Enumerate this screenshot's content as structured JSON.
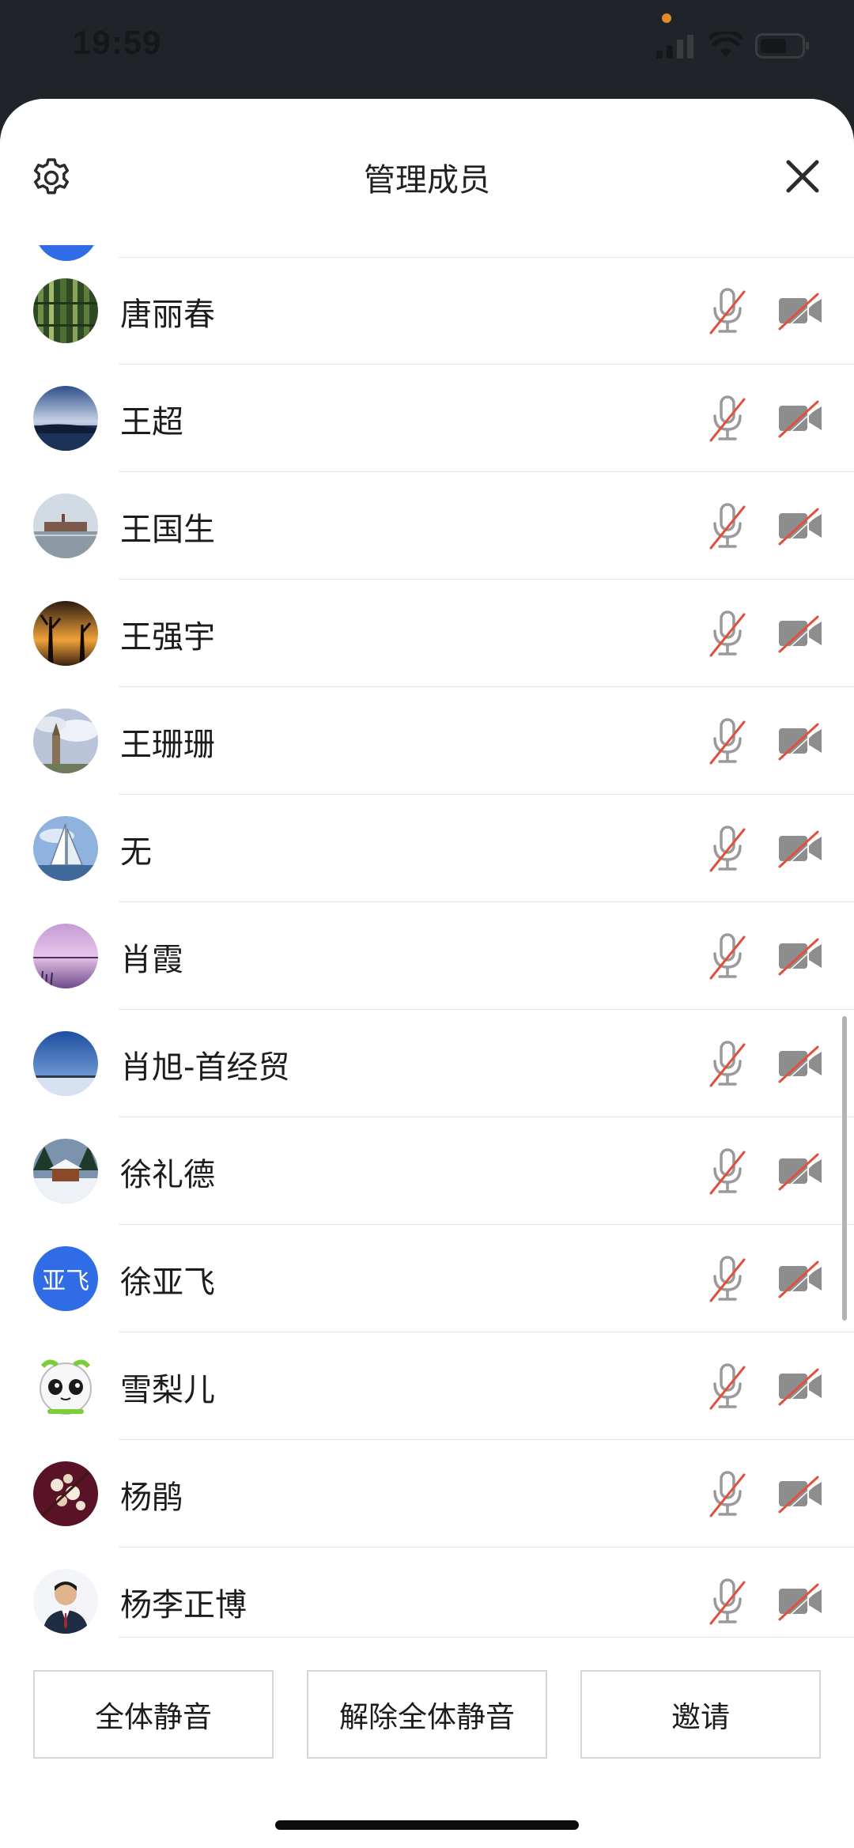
{
  "status_bar": {
    "time": "19:59",
    "icons": [
      "signal-icon",
      "wifi-icon",
      "battery-icon"
    ],
    "recording_dot_color": "#e28a2c"
  },
  "header": {
    "title": "管理成员",
    "settings_icon": "gear-icon",
    "close_icon": "close-icon"
  },
  "members": [
    {
      "name": "唐丽春",
      "avatar": "photo-bamboo"
    },
    {
      "name": "王超",
      "avatar": "photo-seashore-dusk"
    },
    {
      "name": "王国生",
      "avatar": "photo-lakeside-building"
    },
    {
      "name": "王强宇",
      "avatar": "photo-sunset-trees"
    },
    {
      "name": "王珊珊",
      "avatar": "photo-tower-clouds"
    },
    {
      "name": "无",
      "avatar": "photo-sailboat"
    },
    {
      "name": "肖霞",
      "avatar": "photo-purple-lake"
    },
    {
      "name": "肖旭-首经贸",
      "avatar": "photo-blue-sky-pier"
    },
    {
      "name": "徐礼德",
      "avatar": "photo-snowy-cabin"
    },
    {
      "name": "徐亚飞",
      "avatar_text": "亚飞",
      "avatar": "initials"
    },
    {
      "name": "雪梨儿",
      "avatar": "cartoon-panda"
    },
    {
      "name": "杨鹃",
      "avatar": "photo-blossoms"
    },
    {
      "name": "杨李正博",
      "avatar": "photo-portrait"
    }
  ],
  "member_controls": {
    "mic_icon": "mic-muted-icon",
    "camera_icon": "camera-off-icon",
    "muted_slash_color": "#e0513f"
  },
  "footer": {
    "mute_all_label": "全体静音",
    "unmute_all_label": "解除全体静音",
    "invite_label": "邀请"
  },
  "colors": {
    "accent_blue": "#2f6ce6",
    "sheet_background": "#ffffff",
    "backdrop": "#202428"
  }
}
